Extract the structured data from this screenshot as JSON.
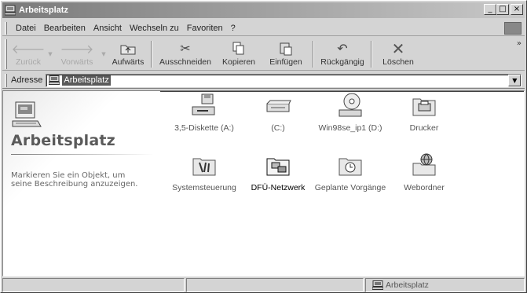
{
  "window": {
    "title": "Arbeitsplatz",
    "controls": [
      "_",
      "□",
      "×"
    ]
  },
  "menu": [
    {
      "label": "Datei"
    },
    {
      "label": "Bearbeiten"
    },
    {
      "label": "Ansicht"
    },
    {
      "label": "Wechseln zu"
    },
    {
      "label": "Favoriten"
    },
    {
      "label": "?"
    }
  ],
  "toolbar": {
    "back": {
      "label": "Zurück",
      "icon": "arrow-left-icon"
    },
    "forward": {
      "label": "Vorwärts",
      "icon": "arrow-right-icon"
    },
    "up": {
      "label": "Aufwärts",
      "icon": "folder-up-icon"
    },
    "cut": {
      "label": "Ausschneiden",
      "icon": "scissors-icon"
    },
    "copy": {
      "label": "Kopieren",
      "icon": "copy-icon"
    },
    "paste": {
      "label": "Einfügen",
      "icon": "paste-icon"
    },
    "undo": {
      "label": "Rückgängig",
      "icon": "undo-icon"
    },
    "delete": {
      "label": "Löschen",
      "icon": "delete-x-icon"
    },
    "more": "»"
  },
  "address": {
    "label": "Adresse",
    "value": "Arbeitsplatz"
  },
  "leftpane": {
    "title": "Arbeitsplatz",
    "description": "Markieren Sie ein Objekt, um seine Beschreibung anzuzeigen."
  },
  "items": [
    {
      "name": "3,5-Diskette (A:)",
      "icon": "floppy-drive-icon"
    },
    {
      "name": "(C:)",
      "icon": "hard-drive-icon"
    },
    {
      "name": "Win98se_ip1 (D:)",
      "icon": "cd-drive-icon"
    },
    {
      "name": "Drucker",
      "icon": "printer-folder-icon"
    },
    {
      "name": "Systemsteuerung",
      "icon": "control-panel-icon"
    },
    {
      "name": "DFÜ-Netzwerk",
      "icon": "dialup-network-icon"
    },
    {
      "name": "Geplante Vorgänge",
      "icon": "scheduled-tasks-icon"
    },
    {
      "name": "Webordner",
      "icon": "web-folders-icon"
    }
  ],
  "statusbar": {
    "location": "Arbeitsplatz"
  }
}
